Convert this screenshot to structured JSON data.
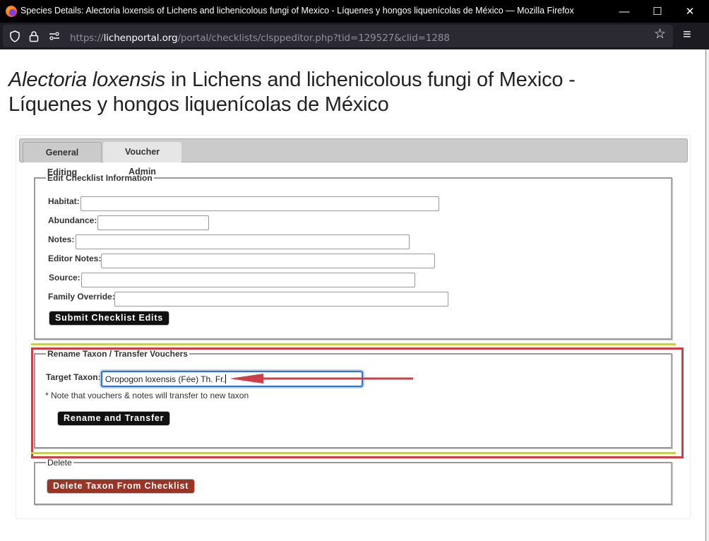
{
  "window": {
    "title": "Species Details: Alectoria loxensis of Lichens and lichenicolous fungi of Mexico - Líquenes y hongos liquenícolas de México — Mozilla Firefox",
    "controls": {
      "minimize": "—",
      "maximize": "☐",
      "close": "✕"
    }
  },
  "browser": {
    "url_prefix": "https://",
    "url_host": "lichenportal.org",
    "url_path": "/portal/checklists/clsppeditor.php?tid=129527&clid=1288",
    "icons": {
      "shield": "shield-icon",
      "lock": "lock-icon",
      "permissions": "permissions-icon",
      "bookmark": "☆",
      "menu": "≡"
    }
  },
  "page": {
    "title_italic": "Alectoria loxensis",
    "title_rest_line1": " in Lichens and lichenicolous fungi of Mexico -",
    "title_line2": "Líquenes y hongos liquenícolas de México",
    "tabs": [
      {
        "label": "General Editing",
        "active": true
      },
      {
        "label": "Voucher Admin",
        "active": false
      }
    ],
    "edit_section": {
      "legend": "Edit Checklist Information",
      "fields": [
        {
          "label": "Habitat:",
          "value": ""
        },
        {
          "label": "Abundance:",
          "value": ""
        },
        {
          "label": "Notes:",
          "value": ""
        },
        {
          "label": "Editor Notes:",
          "value": ""
        },
        {
          "label": "Source:",
          "value": ""
        },
        {
          "label": "Family Override:",
          "value": ""
        }
      ],
      "submit_label": "Submit Checklist Edits"
    },
    "rename_section": {
      "legend": "Rename Taxon / Transfer Vouchers",
      "target_label": "Target Taxon:",
      "target_value": "Oropogon loxensis (Fée) Th. Fr.",
      "note": "* Note that vouchers & notes will transfer to new taxon",
      "button_label": "Rename and Transfer"
    },
    "delete_section": {
      "legend": "Delete",
      "button_label": "Delete Taxon From Checklist"
    },
    "annotation_colors": {
      "highlight_box": "#cb3f46",
      "arrow": "#cb3f46",
      "divider": "#c6cf52"
    }
  }
}
